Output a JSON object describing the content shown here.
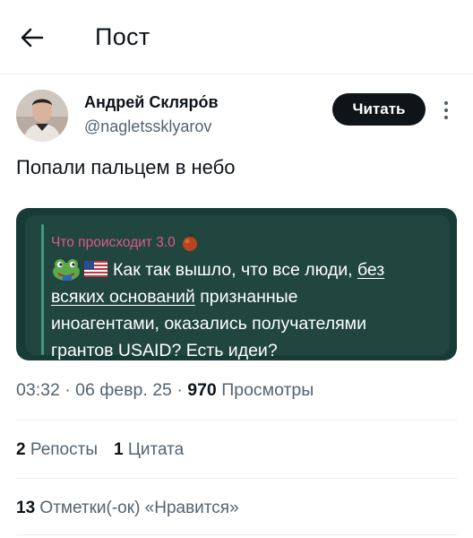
{
  "header": {
    "title": "Пост"
  },
  "author": {
    "name": "Андрей Скляро́в",
    "handle": "@nagletssklyarov",
    "follow_label": "Читать"
  },
  "tweet": {
    "text": "Попали пальцем в небо"
  },
  "quote": {
    "source": "Что происходит 3.0",
    "line1_prefix": "Как так вышло, что все люди,",
    "line1_link": "без",
    "line2_link": "всяких оснований",
    "line2_rest": "признанные",
    "line3": "иноагентами, оказались получателями",
    "line4": "грантов USAID? Есть идеи?"
  },
  "meta": {
    "time": "03:32",
    "date": "06 февр. 25",
    "views_count": "970",
    "views_label": "Просмотры",
    "sep": "·"
  },
  "stats": {
    "reposts_count": "2",
    "reposts_label": "Репосты",
    "quotes_count": "1",
    "quotes_label": "Цитата",
    "likes_count": "13",
    "likes_label": "Отметки(-ок) «Нравится»"
  },
  "colors": {
    "card_bg": "#193b37",
    "card_inner": "#20463f",
    "source_pink": "#e05a8e",
    "secondary_text": "#536471"
  }
}
